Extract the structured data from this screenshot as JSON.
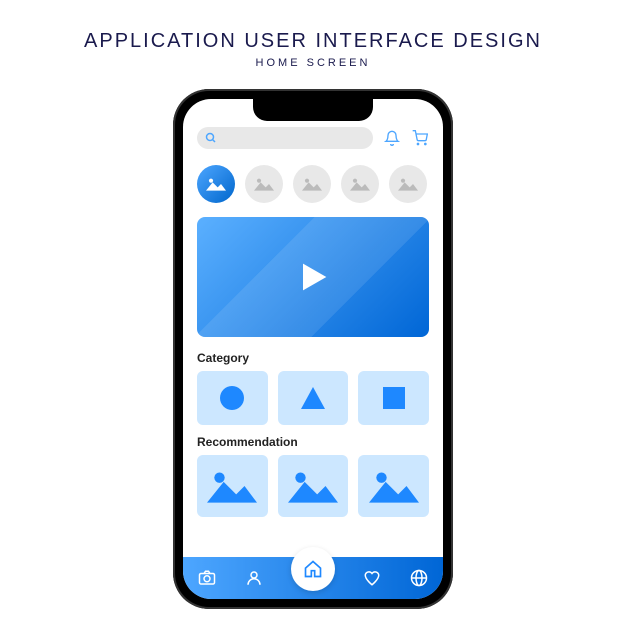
{
  "header": {
    "title": "APPLICATION USER INTERFACE DESIGN",
    "subtitle": "HOME SCREEN"
  },
  "search": {
    "placeholder": ""
  },
  "sections": {
    "category": "Category",
    "recommendation": "Recommendation"
  },
  "stories": [
    {
      "active": true,
      "icon": "image-icon"
    },
    {
      "active": false,
      "icon": "image-icon"
    },
    {
      "active": false,
      "icon": "image-icon"
    },
    {
      "active": false,
      "icon": "image-icon"
    },
    {
      "active": false,
      "icon": "image-icon"
    }
  ],
  "categories": [
    {
      "shape": "circle"
    },
    {
      "shape": "triangle"
    },
    {
      "shape": "square"
    }
  ],
  "recommendations": [
    {
      "icon": "image-icon"
    },
    {
      "icon": "image-icon"
    },
    {
      "icon": "image-icon"
    }
  ],
  "nav": [
    {
      "name": "camera"
    },
    {
      "name": "profile"
    },
    {
      "name": "home"
    },
    {
      "name": "favorites"
    },
    {
      "name": "globe"
    }
  ],
  "colors": {
    "primary": "#0066d6",
    "light": "#cce7ff"
  }
}
